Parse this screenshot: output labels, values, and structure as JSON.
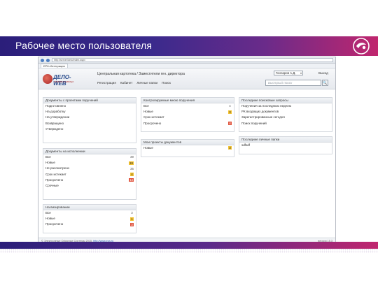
{
  "slide": {
    "title": "Рабочее место пользователя"
  },
  "browser": {
    "address": "http://server/delo/index.aspx",
    "tab": "ЕРК-Интеграция"
  },
  "app": {
    "logo_text": "ДЕЛО-WEB",
    "logo_sub": "главная страница",
    "breadcrumb": "Центральная картотека / Заместители ген. директора",
    "user": "Гончаров А.Д.",
    "exit": "Выход",
    "menu": [
      "Регистрация",
      "Кабинет",
      "Личные папки",
      "Поиск"
    ],
    "search_placeholder": "Быстрый поиск",
    "search_button": "🔍"
  },
  "panels": {
    "projects": {
      "title": "Документы с проектами поручений",
      "rows": [
        "Подготовлено",
        "На доработку",
        "На утверждении",
        "Возвращено",
        "Утверждено"
      ]
    },
    "execution": {
      "title": "Документы на исполнении",
      "rows": [
        {
          "label": "Все",
          "count": "39",
          "style": "plain"
        },
        {
          "label": "Новые",
          "count": "19",
          "style": "yellow"
        },
        {
          "label": "Не рассмотрено",
          "count": "35",
          "style": "plain"
        },
        {
          "label": "Срок истекает",
          "count": "4",
          "style": "yellow"
        },
        {
          "label": "Просрочено",
          "count": "14",
          "style": "red"
        },
        {
          "label": "Срочные",
          "count": "",
          "style": "plain"
        }
      ]
    },
    "approval": {
      "title": "На визировании",
      "rows": [
        {
          "label": "Все",
          "count": "3",
          "style": "plain"
        },
        {
          "label": "Новые",
          "count": "1",
          "style": "yellow"
        },
        {
          "label": "Просрочено",
          "count": "3",
          "style": "red"
        }
      ]
    },
    "control": {
      "title": "Контролируемые мною поручения",
      "rows": [
        {
          "label": "Все",
          "count": "4",
          "style": "plain"
        },
        {
          "label": "Новые",
          "count": "3",
          "style": "yellow"
        },
        {
          "label": "Срок истекает",
          "count": "",
          "style": "plain"
        },
        {
          "label": "Просрочено",
          "count": "4",
          "style": "red"
        }
      ]
    },
    "my_projects": {
      "title": "Мои проекты документов",
      "rows": [
        {
          "label": "Новые",
          "count": "3",
          "style": "yellow"
        }
      ]
    },
    "recent_search": {
      "title": "Последние поисковые запросы",
      "rows": [
        "Поручения за последнюю неделю",
        "РК входящих документов",
        "Зарегистрированные сегодня",
        "Поиск поручений"
      ]
    },
    "recent_folders": {
      "title": "Последние личные папки",
      "rows": [
        "sdfsdf"
      ]
    }
  },
  "footer": {
    "copyright": "© Электронные Офисные Системы 2015,",
    "link": "http://www.eos.ru",
    "version": "версия 15.3"
  }
}
